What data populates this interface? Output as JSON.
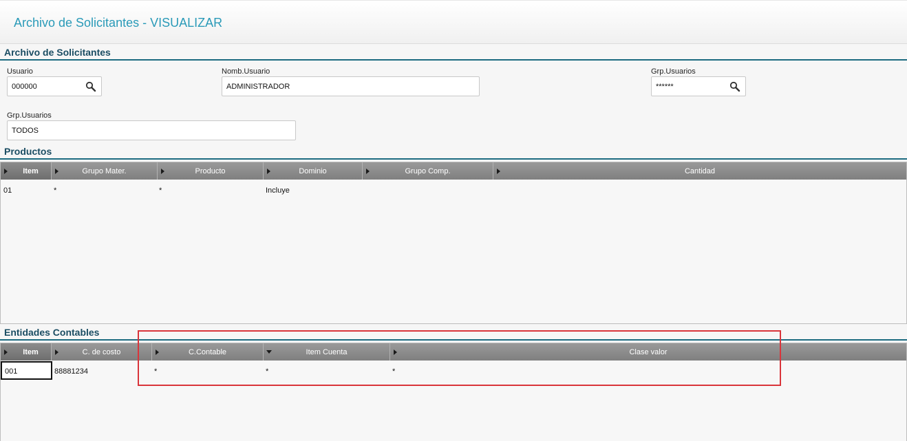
{
  "window": {
    "title": "Archivo de Solicitantes - VISUALIZAR"
  },
  "header_section": {
    "title": "Archivo de Solicitantes",
    "fields": {
      "usuario": {
        "label": "Usuario",
        "value": "000000"
      },
      "nomb_usuario": {
        "label": "Nomb.Usuario",
        "value": "ADMINISTRADOR"
      },
      "grp_usuarios_1": {
        "label": "Grp.Usuarios",
        "value": "******"
      },
      "grp_usuarios_2": {
        "label": "Grp.Usuarios",
        "value": "TODOS"
      }
    }
  },
  "productos": {
    "title": "Productos",
    "columns": [
      "Item",
      "Grupo Mater.",
      "Producto",
      "Dominio",
      "Grupo Comp.",
      "Cantidad"
    ],
    "rows": [
      {
        "item": "01",
        "grupo_mater": "*",
        "producto": "*",
        "dominio": "Incluye",
        "grupo_comp": "",
        "cantidad": ""
      }
    ]
  },
  "entidades": {
    "title": "Entidades Contables",
    "columns": [
      "Item",
      "C. de costo",
      "C.Contable",
      "Item Cuenta",
      "Clase valor"
    ],
    "rows": [
      {
        "item": "001",
        "c_costo": "88881234",
        "c_contable": "*",
        "item_cuenta": "*",
        "clase_valor": "*"
      }
    ]
  },
  "icons": {
    "lookup": "search-icon",
    "column_marker": "triangle-right-icon",
    "sort_marker": "triangle-down-icon"
  },
  "colors": {
    "title": "#2a9ab8",
    "section": "#1b4d63",
    "highlight": "#d9343a"
  }
}
